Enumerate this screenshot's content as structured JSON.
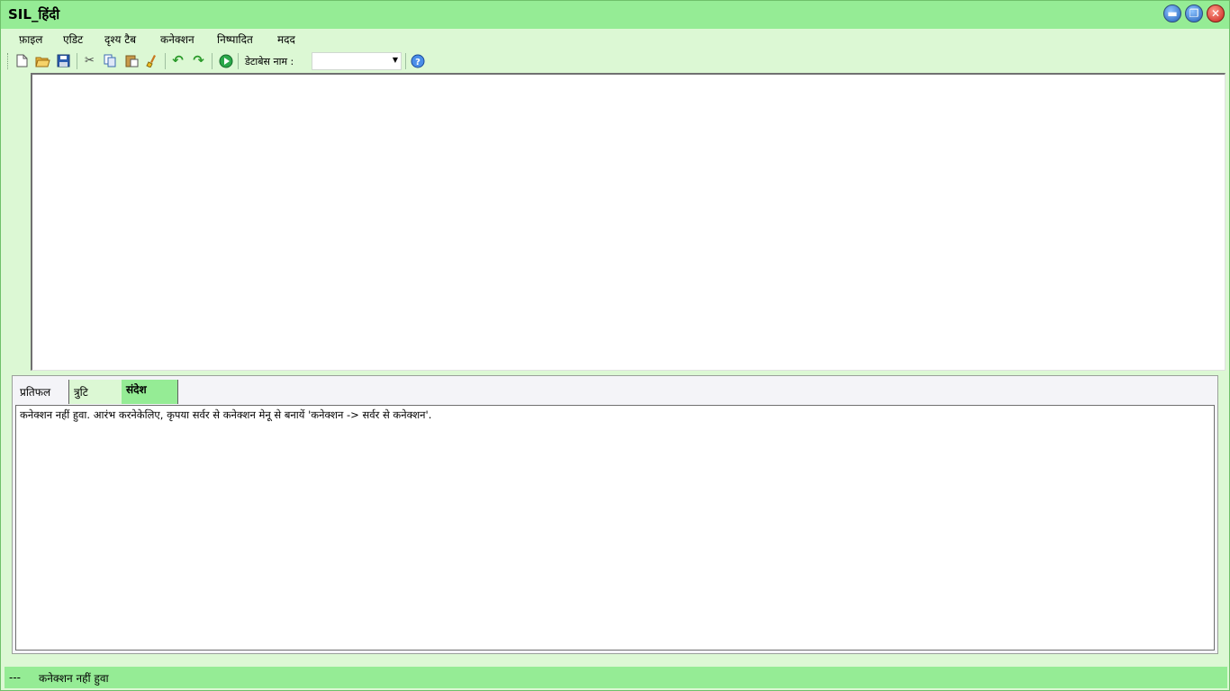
{
  "window": {
    "title": "SIL_हिंदी",
    "minimize_icon": "minus-icon",
    "maximize_icon": "restore-icon",
    "close_icon": "close-icon"
  },
  "menu": {
    "items": [
      "फ़ाइल",
      "एडिट",
      "दृश्य टैब",
      "कनेक्शन",
      "निष्पादित",
      "मदद"
    ]
  },
  "toolbar": {
    "icons": [
      "new-file-icon",
      "open-folder-icon",
      "save-icon",
      "cut-icon",
      "copy-icon",
      "paste-icon",
      "clear-icon",
      "undo-icon",
      "redo-icon",
      "execute-icon",
      "help-icon"
    ],
    "db_label": "डेटाबेस नाम :",
    "db_value": ""
  },
  "tabs": [
    {
      "label": "प्रतिफल"
    },
    {
      "label": "त्रुटि"
    },
    {
      "label": "संदेश"
    }
  ],
  "messages": {
    "text": "कनेक्शन नहीं हुवा. आरंभ करनेकेलिए, कृपया सर्वर से कनेक्शन मेनू से बनायें  'कनेक्शन -> सर्वर से कनेक्शन'."
  },
  "status": {
    "dash": "---",
    "text": "कनेक्शन नहीं हुवा"
  },
  "colors": {
    "title_bar": "#95ec95",
    "background": "#dcf8d4",
    "active_tab": "#95ec95"
  }
}
